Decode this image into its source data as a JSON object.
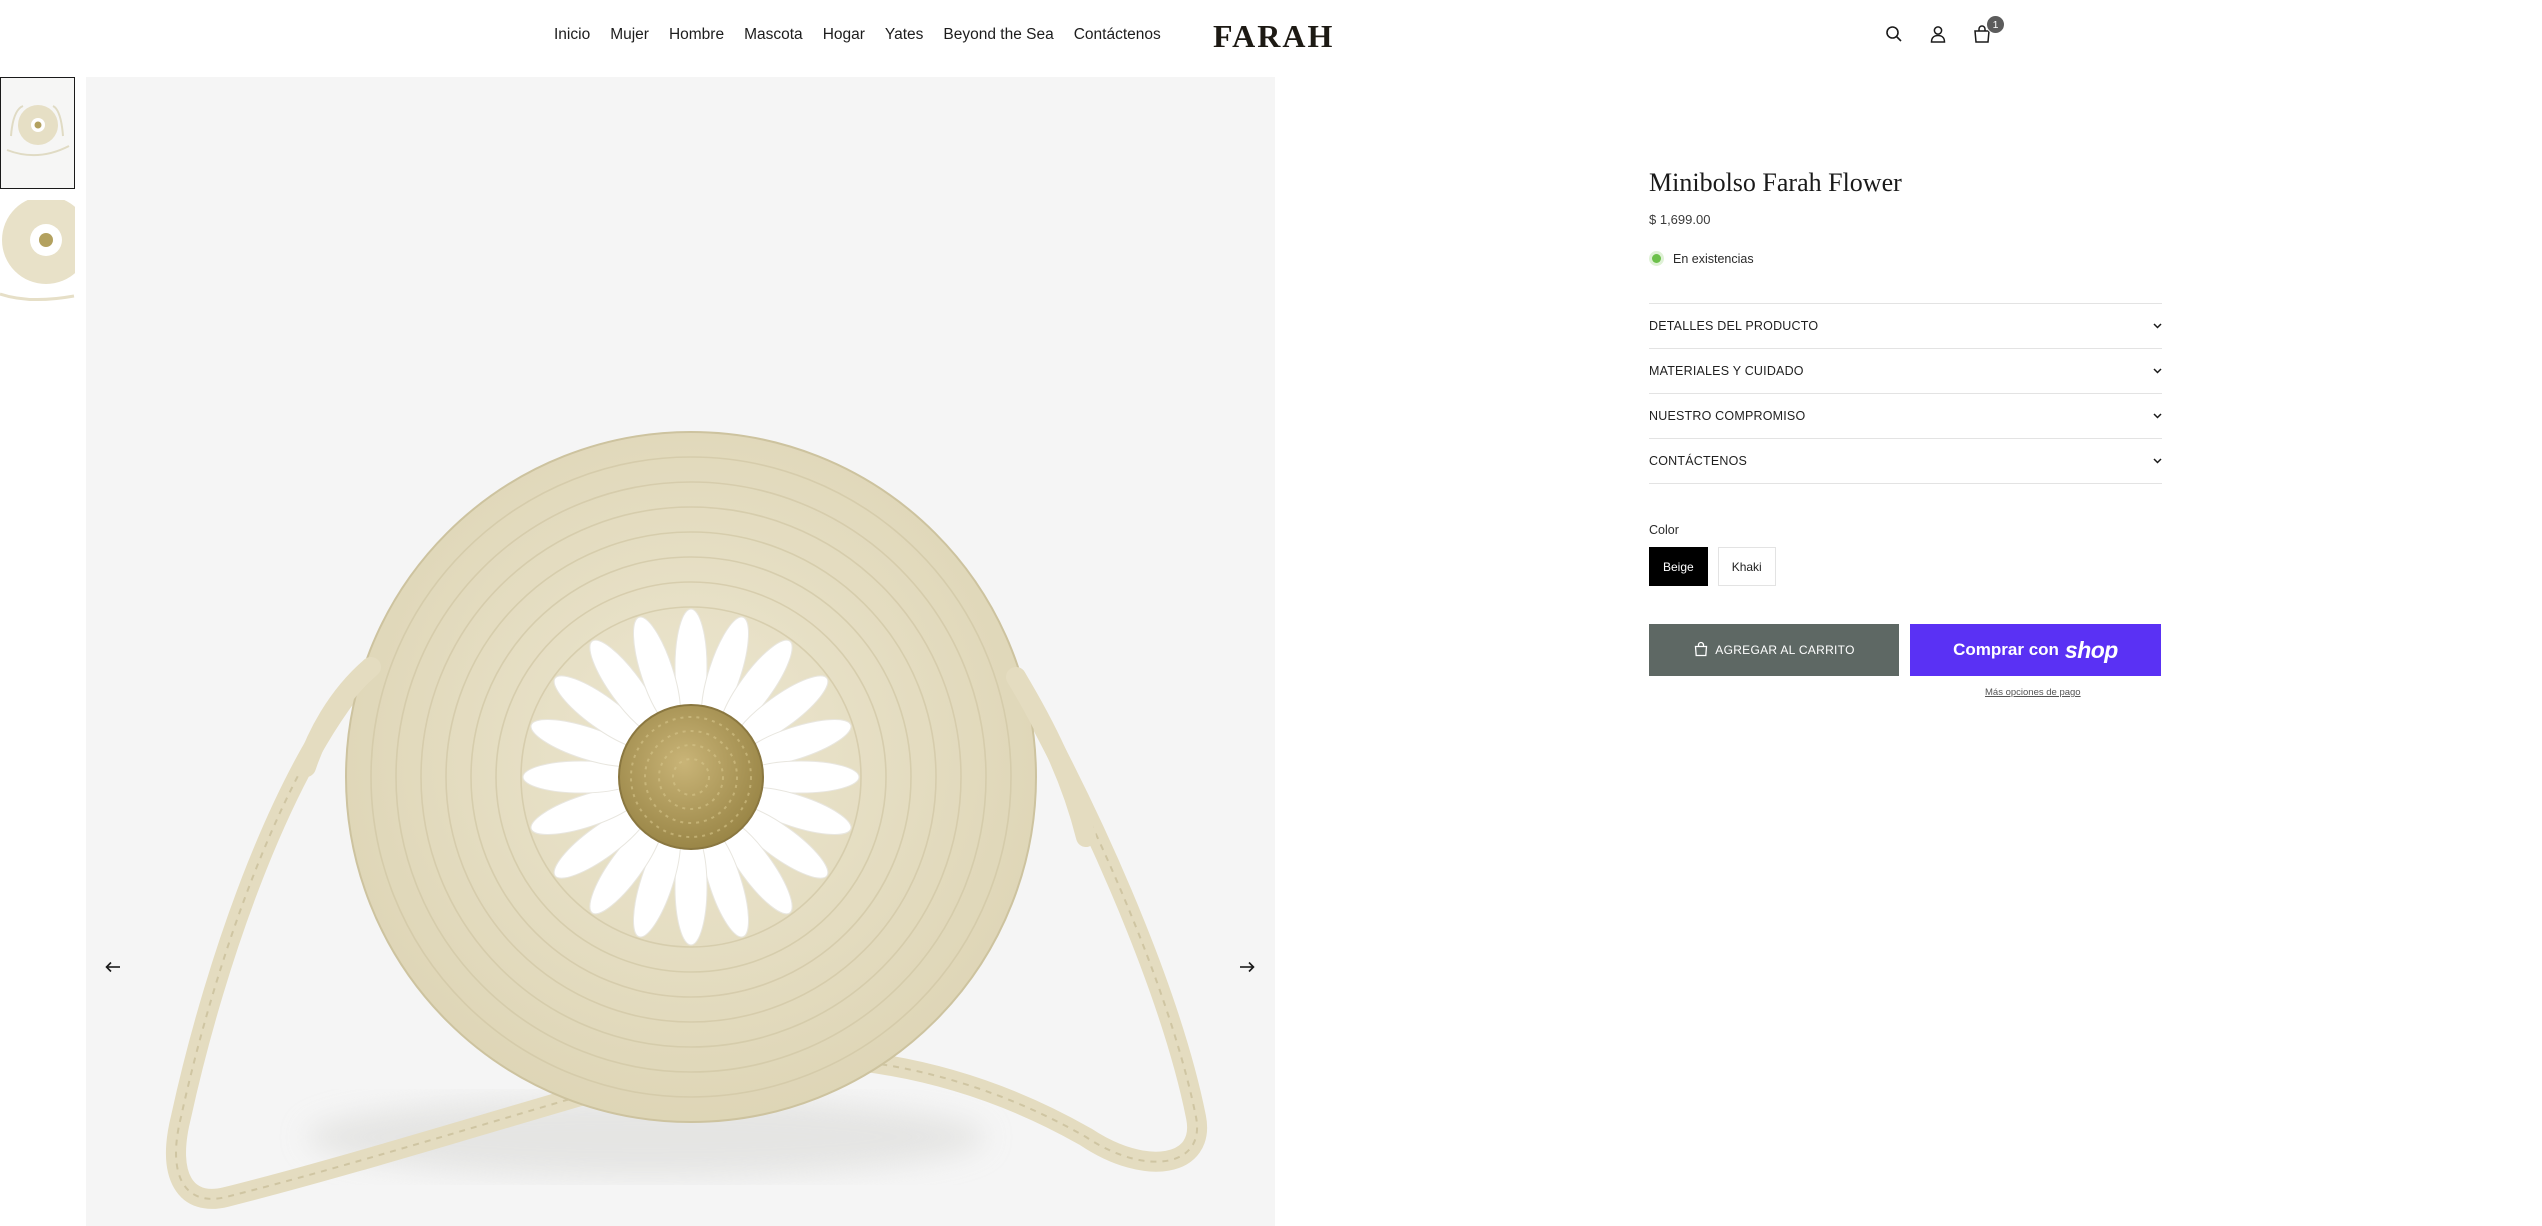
{
  "header": {
    "nav": [
      "Inicio",
      "Mujer",
      "Hombre",
      "Mascota",
      "Hogar",
      "Yates",
      "Beyond the Sea",
      "Contáctenos"
    ],
    "logo": "FARAH",
    "cart_count": "1",
    "icons": [
      "search-icon",
      "account-icon",
      "cart-icon"
    ]
  },
  "gallery": {
    "thumbnails": [
      "bag-full-view",
      "bag-flower-detail"
    ],
    "active_index": 0
  },
  "product": {
    "title": "Minibolso Farah Flower",
    "price": "$ 1,699.00",
    "stock": "En existencias",
    "stock_color": "#6cc04a",
    "accordion": [
      "DETALLES DEL PRODUCTO",
      "MATERIALES Y CUIDADO",
      "NUESTRO COMPROMISO",
      "CONTÁCTENOS"
    ],
    "color_label": "Color",
    "colors": [
      "Beige",
      "Khaki"
    ],
    "selected_color": "Beige",
    "add_to_cart": "AGREGAR AL CARRITO",
    "shop_pay_prefix": "Comprar con",
    "shop_pay_brand": "shop",
    "shop_pay_color": "#5a31f4",
    "more_payment": "Más opciones de pago"
  }
}
